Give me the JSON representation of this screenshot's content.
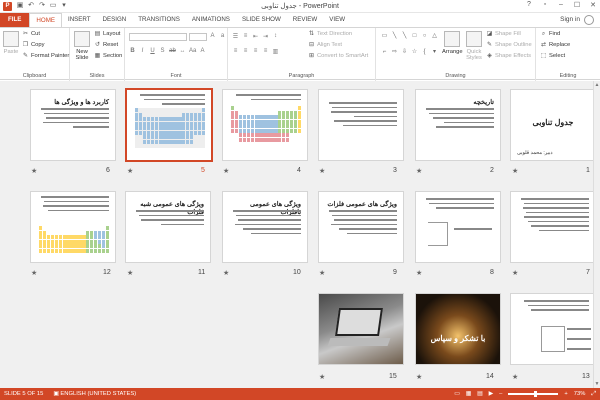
{
  "window": {
    "title": "جدول تناوبی - PowerPoint",
    "signin": "Sign in"
  },
  "tabs": [
    {
      "label": "FILE"
    },
    {
      "label": "HOME"
    },
    {
      "label": "INSERT"
    },
    {
      "label": "DESIGN"
    },
    {
      "label": "TRANSITIONS"
    },
    {
      "label": "ANIMATIONS"
    },
    {
      "label": "SLIDE SHOW"
    },
    {
      "label": "REVIEW"
    },
    {
      "label": "VIEW"
    }
  ],
  "ribbon": {
    "clipboard": {
      "label": "Clipboard",
      "paste": "Paste",
      "cut": "Cut",
      "copy": "Copy",
      "format_painter": "Format Painter"
    },
    "slides": {
      "label": "Slides",
      "new_slide": "New Slide",
      "layout": "Layout",
      "reset": "Reset",
      "section": "Section"
    },
    "font": {
      "label": "Font"
    },
    "paragraph": {
      "label": "Paragraph",
      "text_direction": "Text Direction",
      "align_text": "Align Text",
      "convert_smartart": "Convert to SmartArt"
    },
    "drawing": {
      "label": "Drawing",
      "arrange": "Arrange",
      "quick_styles": "Quick Styles",
      "shape_fill": "Shape Fill",
      "shape_outline": "Shape Outline",
      "shape_effects": "Shape Effects"
    },
    "editing": {
      "label": "Editing",
      "find": "Find",
      "replace": "Replace",
      "select": "Select"
    }
  },
  "slides": [
    {
      "num": "1",
      "title": "جدول تناوبی",
      "subtitle": "دبیر: محمد قلوبی"
    },
    {
      "num": "2",
      "title": "تاریخچه"
    },
    {
      "num": "3",
      "title": ""
    },
    {
      "num": "4",
      "title": ""
    },
    {
      "num": "5",
      "title": ""
    },
    {
      "num": "6",
      "title": "کاربرد ها و ویژگی ها"
    },
    {
      "num": "7",
      "title": ""
    },
    {
      "num": "8",
      "title": ""
    },
    {
      "num": "9",
      "title": "ویژگی های عمومی فلزات"
    },
    {
      "num": "10",
      "title": "ویژگی های عمومی نافلزات"
    },
    {
      "num": "11",
      "title": "ویژگی های عمومی شبه فلزات"
    },
    {
      "num": "12",
      "title": ""
    },
    {
      "num": "13",
      "title": ""
    },
    {
      "num": "14",
      "title": "با تشکر و سپاس"
    },
    {
      "num": "15",
      "title": ""
    }
  ],
  "status": {
    "slide": "SLIDE 5 OF 15",
    "language": "ENGLISH (UNITED STATES)",
    "zoom": "73%"
  },
  "icons": {
    "star": "★"
  }
}
